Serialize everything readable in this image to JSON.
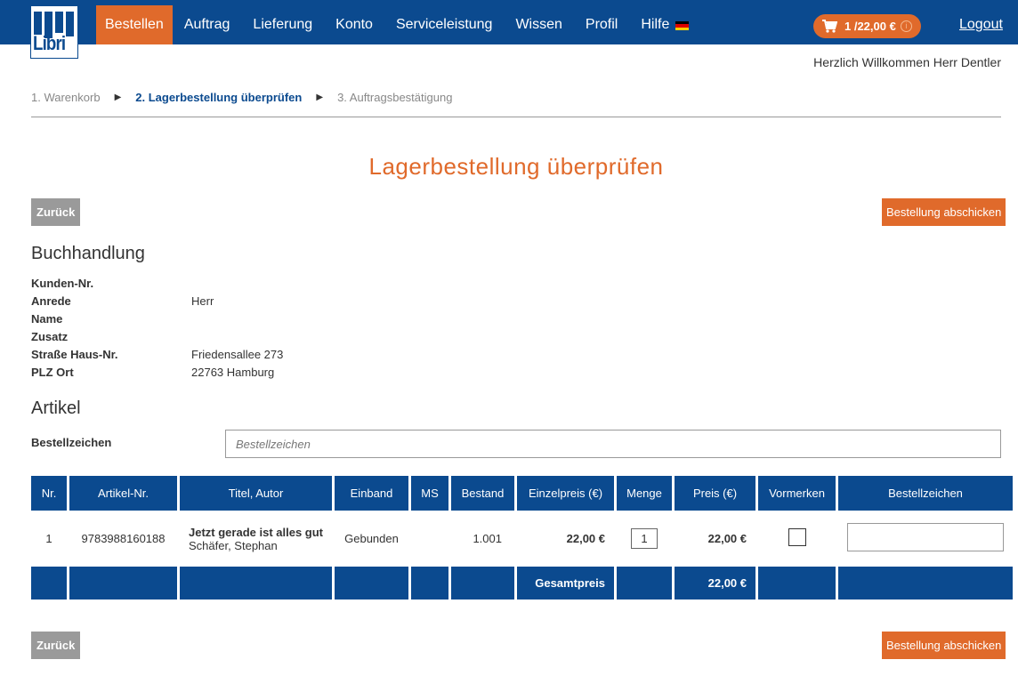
{
  "brand": {
    "logo_text": "Libri",
    "color": "#0b4a8f",
    "accent": "#e06a2b"
  },
  "nav": {
    "items": [
      {
        "label": "Bestellen",
        "active": true
      },
      {
        "label": "Auftrag"
      },
      {
        "label": "Lieferung"
      },
      {
        "label": "Konto"
      },
      {
        "label": "Serviceleistung"
      },
      {
        "label": "Wissen"
      },
      {
        "label": "Profil"
      },
      {
        "label": "Hilfe"
      }
    ],
    "language_icon": "german-flag-icon",
    "cart": {
      "label": "1 /22,00 €",
      "icon": "cart-icon",
      "info_icon": "info-icon",
      "info_glyph": "i"
    },
    "logout": "Logout"
  },
  "welcome": "Herzlich Willkommen Herr Dentler",
  "breadcrumb": {
    "steps": [
      "1. Warenkorb",
      "2. Lagerbestellung überprüfen",
      "3. Auftragsbestätigung"
    ],
    "separator": "▶"
  },
  "page_title": "Lagerbestellung überprüfen",
  "buttons": {
    "back": "Zurück",
    "submit": "Bestellung abschicken"
  },
  "buchhandlung": {
    "title": "Buchhandlung",
    "rows": [
      {
        "label": "Kunden-Nr.",
        "value": ""
      },
      {
        "label": "Anrede",
        "value": "Herr"
      },
      {
        "label": "Name",
        "value": ""
      },
      {
        "label": "Zusatz",
        "value": ""
      },
      {
        "label": "Straße Haus-Nr.",
        "value": "Friedensallee 273"
      },
      {
        "label": "PLZ Ort",
        "value": "22763 Hamburg"
      }
    ]
  },
  "artikel": {
    "title": "Artikel",
    "bestellzeichen_label": "Bestellzeichen",
    "bestellzeichen_placeholder": "Bestellzeichen"
  },
  "table": {
    "headers": [
      "Nr.",
      "Artikel-Nr.",
      "Titel, Autor",
      "Einband",
      "MS",
      "Bestand",
      "Einzelpreis (€)",
      "Menge",
      "Preis (€)",
      "Vormerken",
      "Bestellzeichen"
    ],
    "rows": [
      {
        "nr": "1",
        "artikel_nr": "9783988160188",
        "titel": "Jetzt gerade ist alles gut",
        "autor": "Schäfer, Stephan",
        "einband": "Gebunden",
        "ms": "",
        "bestand": "1.001",
        "einzelpreis": "22,00 €",
        "menge": "1",
        "preis": "22,00 €",
        "vormerken": false
      }
    ],
    "total_label": "Gesamtpreis",
    "total_value": "22,00 €"
  }
}
